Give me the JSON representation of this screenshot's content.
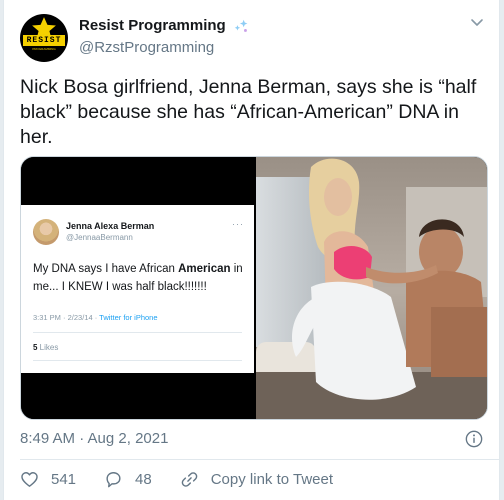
{
  "account": {
    "display_name": "Resist Programming",
    "handle": "@RzstProgramming",
    "avatar_text": "RESIST",
    "avatar_subtext": "PROGRAMMING"
  },
  "tweet": {
    "text": "Nick Bosa girlfriend, Jenna Berman, says she is “half black” because she has “African-American” DNA in her.",
    "timestamp": "8:49 AM · Aug 2, 2021"
  },
  "embedded_tweet": {
    "name": "Jenna Alexa Berman",
    "handle": "@JennaaBermann",
    "text_before": "My DNA says I have African ",
    "text_bold": "American",
    "text_after": " in me... I KNEW I was half black!!!!!!!",
    "time": "3:31 PM · 2/23/14 · ",
    "client": "Twitter for iPhone",
    "likes_count": "5",
    "likes_label": " Likes",
    "menu": "···"
  },
  "actions": {
    "likes": "541",
    "replies": "48",
    "copy_link": "Copy link to Tweet"
  },
  "colors": {
    "text": "#14171a",
    "secondary": "#657786",
    "link": "#1da1f2",
    "avatar_yellow": "#f5d000"
  }
}
